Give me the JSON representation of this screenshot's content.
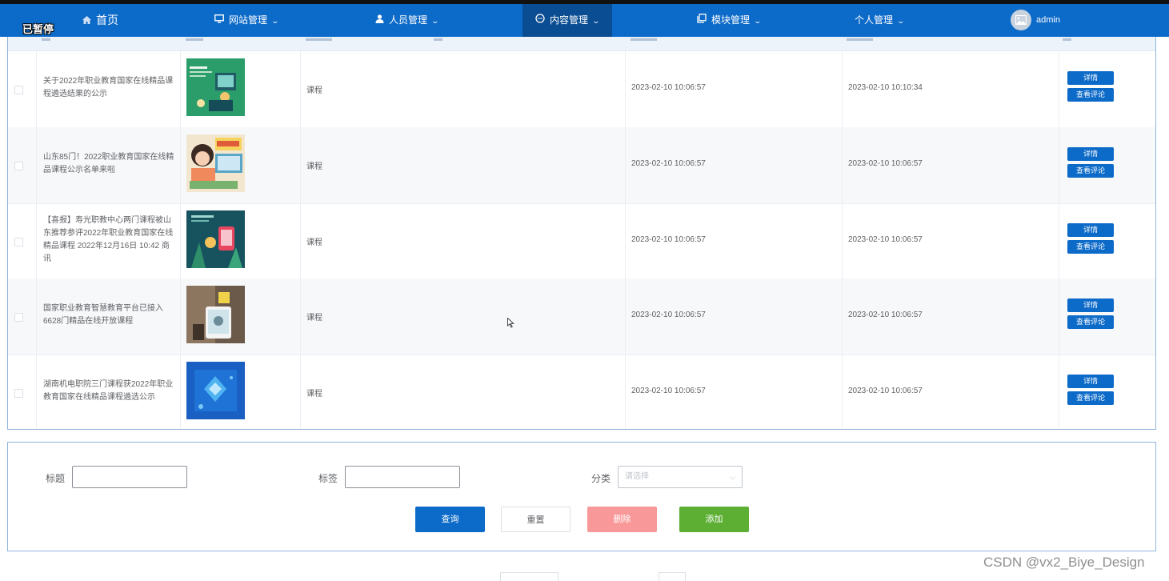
{
  "overlay": {
    "paused_label": "已暂停"
  },
  "nav": {
    "home": "首页",
    "items": [
      {
        "label": "网站管理",
        "icon": "monitor-icon"
      },
      {
        "label": "人员管理",
        "icon": "user-icon"
      },
      {
        "label": "内容管理",
        "icon": "chat-icon",
        "active": true
      },
      {
        "label": "模块管理",
        "icon": "copy-icon"
      },
      {
        "label": "个人管理",
        "icon": ""
      }
    ],
    "username": "admin"
  },
  "table": {
    "rows": [
      {
        "title": "关于2022年职业教育国家在线精品课程遴选结果的公示",
        "tag": "课程",
        "created": "2023-02-10 10:06:57",
        "updated": "2023-02-10 10:10:34"
      },
      {
        "title": "山东85门！2022职业教育国家在线精品课程公示名单来啦",
        "tag": "课程",
        "created": "2023-02-10 10:06:57",
        "updated": "2023-02-10 10:06:57"
      },
      {
        "title": "【喜报】寿光职教中心两门课程被山东推荐参评2022年职业教育国家在线精品课程 2022年12月16日 10:42 商讯",
        "tag": "课程",
        "created": "2023-02-10 10:06:57",
        "updated": "2023-02-10 10:06:57"
      },
      {
        "title": "国家职业教育智慧教育平台已接入6628门精品在线开放课程",
        "tag": "课程",
        "created": "2023-02-10 10:06:57",
        "updated": "2023-02-10 10:06:57"
      },
      {
        "title": "湖南机电职院三门课程获2022年职业教育国家在线精品课程遴选公示",
        "tag": "课程",
        "created": "2023-02-10 10:06:57",
        "updated": "2023-02-10 10:06:57"
      }
    ],
    "detail_label": "详情",
    "comments_label": "查看评论"
  },
  "form": {
    "title_label": "标题",
    "tag_label": "标签",
    "category_label": "分类",
    "category_placeholder": "请选择",
    "search_label": "查询",
    "reset_label": "重置",
    "delete_label": "删除",
    "add_label": "添加"
  },
  "colors": {
    "primary": "#0c6ac8",
    "danger": "#f89898",
    "success": "#5daf34"
  },
  "watermark": "CSDN @vx2_Biye_Design"
}
